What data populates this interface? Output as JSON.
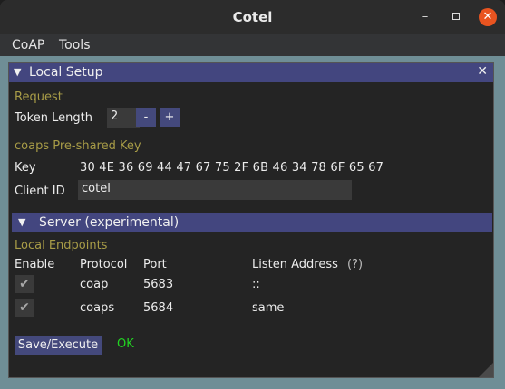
{
  "window": {
    "title": "Cotel",
    "minimize": "–",
    "close": "✕"
  },
  "menu": {
    "items": [
      "CoAP",
      "Tools"
    ]
  },
  "panel": {
    "title": "Local Setup",
    "close": "✕",
    "request_header": "Request",
    "token_label": "Token Length",
    "token_value": "2",
    "minus": "-",
    "plus": "+",
    "psk_header": "coaps Pre-shared Key",
    "key_label": "Key",
    "key_value": "30 4E 36 69 44 47 67 75 2F 6B 46 34 78 6F 65 67",
    "client_label": "Client ID",
    "client_value": "cotel",
    "server_section": "Server (experimental)",
    "endpoints_header": "Local Endpoints",
    "columns": {
      "enable": "Enable",
      "protocol": "Protocol",
      "port": "Port",
      "listen": "Listen Address",
      "help": "(?)"
    },
    "rows": [
      {
        "enabled": true,
        "protocol": "coap",
        "port": "5683",
        "address": "::"
      },
      {
        "enabled": true,
        "protocol": "coaps",
        "port": "5684",
        "address": "same"
      }
    ],
    "save_label": "Save/Execute",
    "status": "OK"
  },
  "colors": {
    "accent": "#43467f",
    "section_label": "#a89c47",
    "ok": "#22d422",
    "close": "#e95420"
  }
}
